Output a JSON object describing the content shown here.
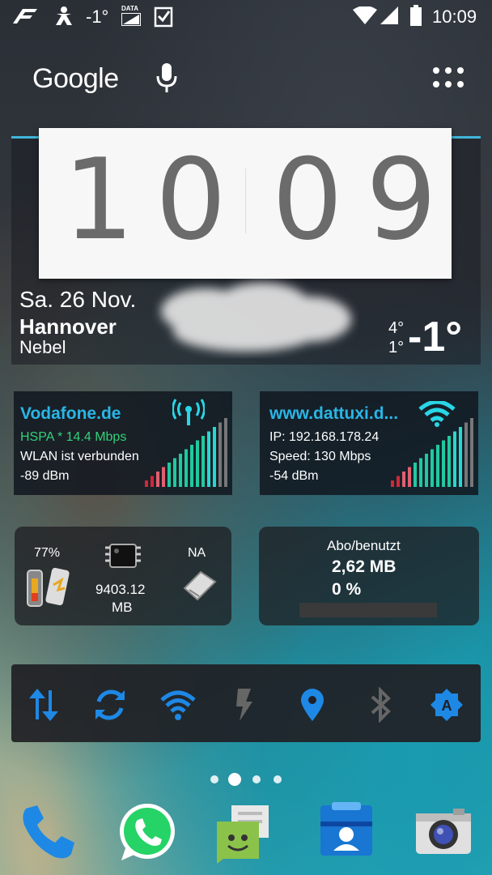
{
  "statusbar": {
    "temperature": "-1°",
    "data_label": "DATA",
    "time": "10:09"
  },
  "search": {
    "logo_text": "Google"
  },
  "clock": {
    "hour_tens": "1",
    "hour_ones": "0",
    "minute_tens": "0",
    "minute_ones": "9",
    "date": "Sa. 26 Nov.",
    "city": "Hannover",
    "condition": "Nebel",
    "temp_high": "4°",
    "temp_low": "1°",
    "temp_current": "-1°"
  },
  "mobile_network": {
    "operator": "Vodafone.de",
    "type_speed": "HSPA * 14.4 Mbps",
    "wlan_status": "WLAN ist verbunden",
    "signal": "-89 dBm",
    "icon": "antenna-icon"
  },
  "wifi_network": {
    "ssid": "www.dattuxi.d...",
    "ip": "IP: 192.168.178.24",
    "speed": "Speed: 130 Mbps",
    "signal": "-54 dBm",
    "icon": "wifi-icon"
  },
  "system_stats": {
    "battery_percent": "77%",
    "memory_value": "9403.12",
    "memory_unit": "MB",
    "sd_label": "NA"
  },
  "data_usage": {
    "header": "Abo/benutzt",
    "used": "2,62 MB",
    "percent": "0 %",
    "progress": 0
  },
  "quick_toggles": [
    {
      "name": "mobile-data-toggle",
      "icon": "data-arrows-icon",
      "active": true
    },
    {
      "name": "sync-toggle",
      "icon": "sync-icon",
      "active": true
    },
    {
      "name": "wifi-toggle",
      "icon": "wifi-icon",
      "active": true
    },
    {
      "name": "flashlight-toggle",
      "icon": "flash-icon",
      "active": false
    },
    {
      "name": "location-toggle",
      "icon": "location-pin-icon",
      "active": true
    },
    {
      "name": "bluetooth-toggle",
      "icon": "bluetooth-icon",
      "active": false
    },
    {
      "name": "auto-brightness-toggle",
      "icon": "brightness-auto-icon",
      "active": true
    }
  ],
  "page_indicator": {
    "count": 4,
    "current": 2
  },
  "dock": [
    {
      "name": "phone-app",
      "icon": "phone-icon"
    },
    {
      "name": "whatsapp-app",
      "icon": "whatsapp-icon"
    },
    {
      "name": "messaging-app",
      "icon": "messaging-icon"
    },
    {
      "name": "contacts-app",
      "icon": "contacts-icon"
    },
    {
      "name": "camera-app",
      "icon": "camera-icon"
    }
  ],
  "colors": {
    "accent": "#29b6e6",
    "hspa_green": "#33d17a"
  }
}
